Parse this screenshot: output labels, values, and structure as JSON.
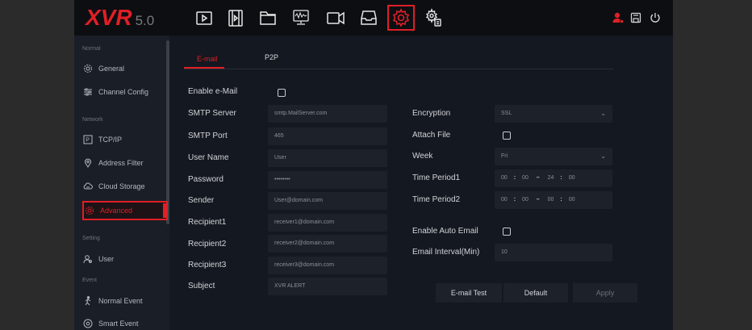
{
  "app": {
    "logo": "XVR",
    "version": "5.0",
    "accent": "#e01f26"
  },
  "topnav": [
    {
      "name": "playback-icon"
    },
    {
      "name": "video-file-icon"
    },
    {
      "name": "folder-icon"
    },
    {
      "name": "monitor-icon"
    },
    {
      "name": "camera-icon"
    },
    {
      "name": "storage-icon"
    },
    {
      "name": "settings-gear-icon",
      "active": true
    },
    {
      "name": "system-settings-icon"
    }
  ],
  "sidebar": {
    "sections": {
      "normal": "Normal",
      "network": "Network",
      "setting": "Setting",
      "event": "Event"
    },
    "items": {
      "general": "General",
      "channel_config": "Channel Config",
      "tcpip": "TCP/IP",
      "address_filter": "Address Filter",
      "cloud_storage": "Cloud Storage",
      "advanced": "Advanced",
      "user": "User",
      "normal_event": "Normal Event",
      "smart_event": "Smart Event"
    }
  },
  "tabs": {
    "email": "E-mail",
    "p2p": "P2P"
  },
  "form": {
    "enable_email": "Enable e-Mail",
    "smtp_server": {
      "label": "SMTP Server",
      "value": "smtp.MailServer.com"
    },
    "smtp_port": {
      "label": "SMTP Port",
      "value": "465"
    },
    "user_name": {
      "label": "User Name",
      "value": "User"
    },
    "password": {
      "label": "Password",
      "value": "••••••••"
    },
    "sender": {
      "label": "Sender",
      "value": "User@domain.com"
    },
    "recipient1": {
      "label": "Recipient1",
      "value": "receiver1@domain.com"
    },
    "recipient2": {
      "label": "Recipient2",
      "value": "receiver2@domain.com"
    },
    "recipient3": {
      "label": "Recipient3",
      "value": "receiver3@domain.com"
    },
    "subject": {
      "label": "Subject",
      "value": "XVR ALERT"
    },
    "encryption": {
      "label": "Encryption",
      "value": "SSL"
    },
    "attach_file": "Attach File",
    "week": {
      "label": "Week",
      "value": "Fri"
    },
    "time_period1": {
      "label": "Time Period1",
      "start_h": "00",
      "start_m": "00",
      "end_h": "24",
      "end_m": "00"
    },
    "time_period2": {
      "label": "Time Period2",
      "start_h": "00",
      "start_m": "00",
      "end_h": "00",
      "end_m": "00"
    },
    "enable_auto_email": "Enable Auto Email",
    "email_interval": {
      "label": "Email Interval(Min)",
      "value": "10"
    },
    "sep_colon": ":",
    "sep_dash": "–"
  },
  "buttons": {
    "email_test": "E-mail Test",
    "default": "Default",
    "apply": "Apply"
  }
}
